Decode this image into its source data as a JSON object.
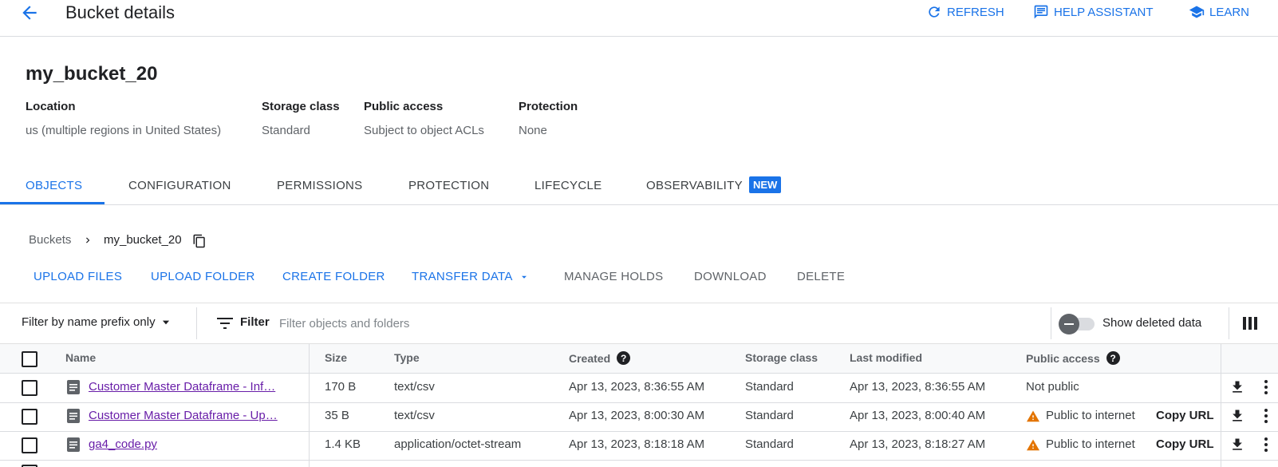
{
  "header": {
    "title": "Bucket details",
    "actions": {
      "refresh": "REFRESH",
      "help_assistant": "HELP ASSISTANT",
      "learn": "LEARN"
    }
  },
  "bucket": {
    "name": "my_bucket_20",
    "info": [
      {
        "label": "Location",
        "value": "us (multiple regions in United States)"
      },
      {
        "label": "Storage class",
        "value": "Standard"
      },
      {
        "label": "Public access",
        "value": "Subject to object ACLs"
      },
      {
        "label": "Protection",
        "value": "None"
      }
    ]
  },
  "tabs": [
    {
      "label": "OBJECTS",
      "active": true
    },
    {
      "label": "CONFIGURATION"
    },
    {
      "label": "PERMISSIONS"
    },
    {
      "label": "PROTECTION"
    },
    {
      "label": "LIFECYCLE"
    },
    {
      "label": "OBSERVABILITY"
    }
  ],
  "new_badge": "NEW",
  "breadcrumb": {
    "root": "Buckets",
    "current": "my_bucket_20"
  },
  "actions": {
    "upload_files": "UPLOAD FILES",
    "upload_folder": "UPLOAD FOLDER",
    "create_folder": "CREATE FOLDER",
    "transfer_data": "TRANSFER DATA",
    "manage_holds": "MANAGE HOLDS",
    "download": "DOWNLOAD",
    "delete": "DELETE"
  },
  "filter": {
    "prefix_mode": "Filter by name prefix only",
    "filter_label": "Filter",
    "placeholder": "Filter objects and folders",
    "show_deleted_label": "Show deleted data"
  },
  "table": {
    "headers": {
      "name": "Name",
      "size": "Size",
      "type": "Type",
      "created": "Created",
      "storage_class": "Storage class",
      "last_modified": "Last modified",
      "public_access": "Public access"
    },
    "rows": [
      {
        "name": "Customer Master Dataframe - Inf…",
        "size": "170 B",
        "type": "text/csv",
        "created": "Apr 13, 2023, 8:36:55 AM",
        "storage_class": "Standard",
        "last_modified": "Apr 13, 2023, 8:36:55 AM",
        "public_access": "Not public"
      },
      {
        "name": "Customer Master Dataframe - Up…",
        "size": "35 B",
        "type": "text/csv",
        "created": "Apr 13, 2023, 8:00:30 AM",
        "storage_class": "Standard",
        "last_modified": "Apr 13, 2023, 8:00:40 AM",
        "public_access": "Public to internet",
        "copy_url": "Copy URL"
      },
      {
        "name": "ga4_code.py",
        "size": "1.4 KB",
        "type": "application/octet-stream",
        "created": "Apr 13, 2023, 8:18:18 AM",
        "storage_class": "Standard",
        "last_modified": "Apr 13, 2023, 8:18:27 AM",
        "public_access": "Public to internet",
        "copy_url": "Copy URL"
      }
    ]
  },
  "colors": {
    "accent": "#1a73e8",
    "visited_link": "#681da8",
    "warning": "#e37400"
  }
}
